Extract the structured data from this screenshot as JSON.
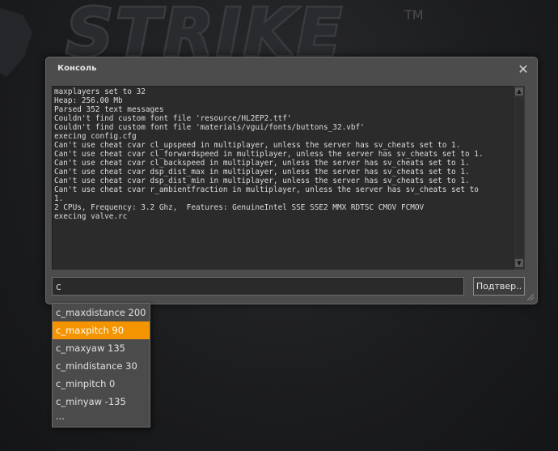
{
  "background": {
    "logo_text": "STRIKE",
    "trademark": "TM"
  },
  "console": {
    "title": "Консоль",
    "close_glyph": "✕",
    "log_lines": [
      "maxplayers set to 32",
      "Heap: 256.00 Mb",
      "Parsed 352 text messages",
      "Couldn't find custom font file 'resource/HL2EP2.ttf'",
      "Couldn't find custom font file 'materials/vgui/fonts/buttons_32.vbf'",
      "execing config.cfg",
      "Can't use cheat cvar cl_upspeed in multiplayer, unless the server has sv_cheats set to 1.",
      "Can't use cheat cvar cl_forwardspeed in multiplayer, unless the server has sv_cheats set to 1.",
      "Can't use cheat cvar cl_backspeed in multiplayer, unless the server has sv_cheats set to 1.",
      "Can't use cheat cvar dsp_dist_max in multiplayer, unless the server has sv_cheats set to 1.",
      "Can't use cheat cvar dsp_dist_min in multiplayer, unless the server has sv_cheats set to 1.",
      "Can't use cheat cvar r_ambientfraction in multiplayer, unless the server has sv_cheats set to",
      "1.",
      "2 CPUs, Frequency: 3.2 Ghz,  Features: GenuineIntel SSE SSE2 MMX RDTSC CMOV FCMOV",
      "execing valve.rc"
    ],
    "input_value": "c",
    "submit_label": "Подтвер.."
  },
  "suggestions": {
    "items": [
      "c_maxdistance 200",
      "c_maxpitch 90",
      "c_maxyaw 135",
      "c_mindistance 30",
      "c_minpitch 0",
      "c_minyaw -135",
      "..."
    ],
    "selected_index": 1,
    "highlight_color": "#f39400"
  }
}
